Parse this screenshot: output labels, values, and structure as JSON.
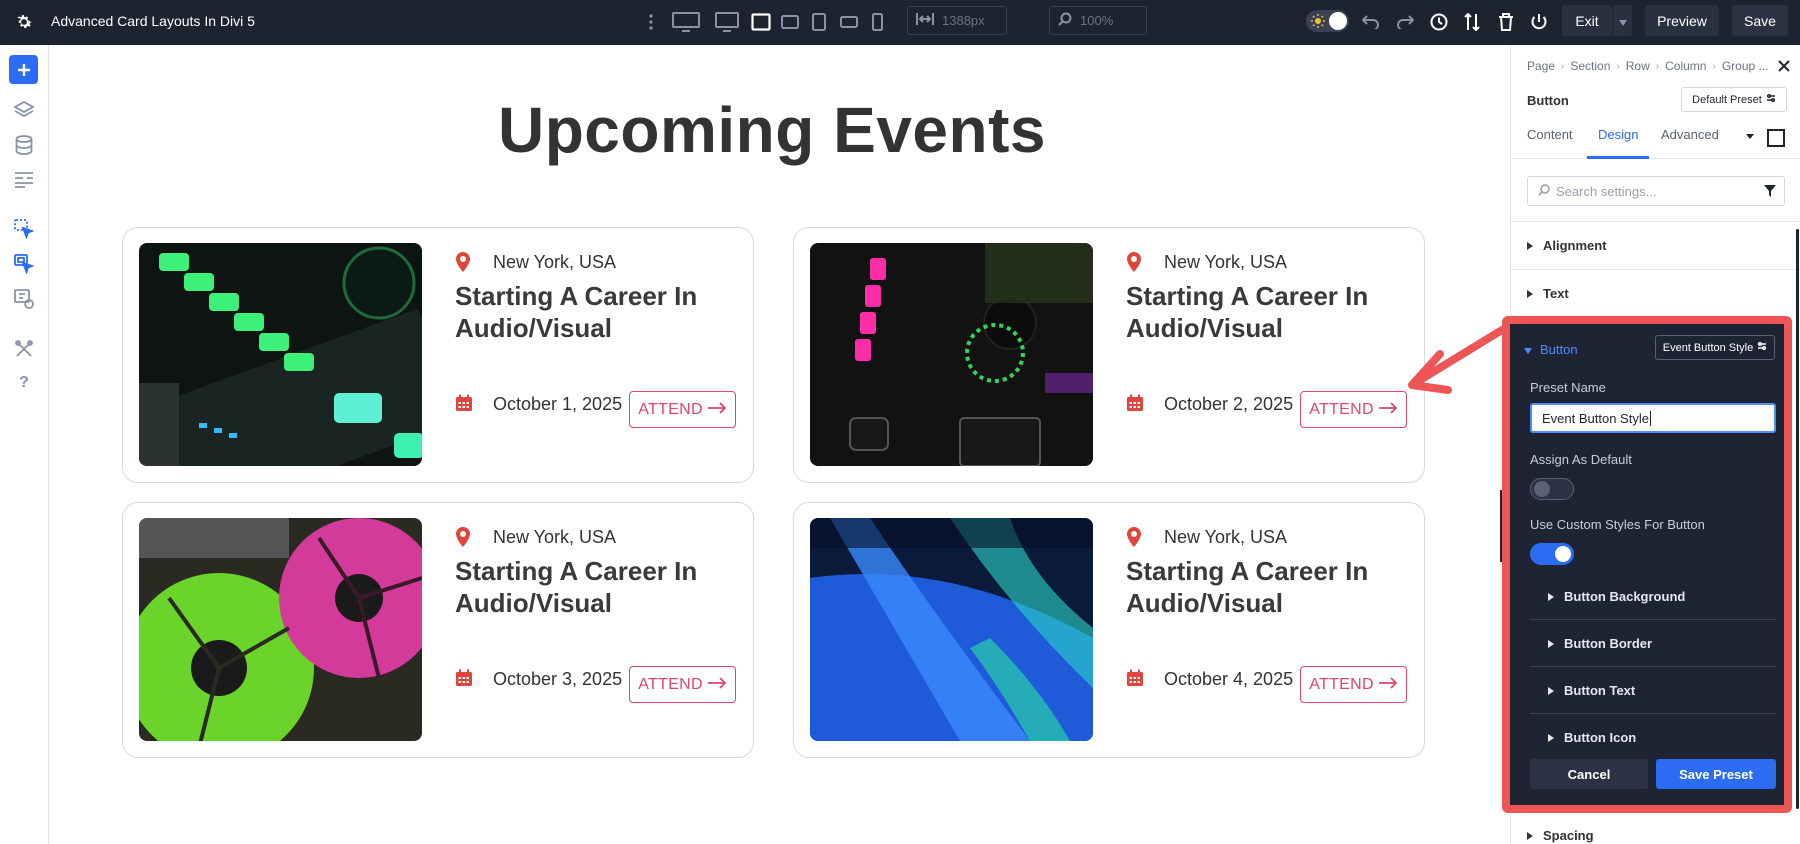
{
  "topbar": {
    "title": "Advanced Card Layouts In Divi 5",
    "width_value": "1388px",
    "zoom_value": "100%",
    "exit_label": "Exit",
    "preview_label": "Preview",
    "save_label": "Save",
    "icons": [
      "gear-icon",
      "more-vertical-icon",
      "desktop-wide-icon",
      "desktop-icon",
      "laptop-icon",
      "tablet-landscape-icon",
      "tablet-portrait-icon",
      "phone-landscape-icon",
      "phone-portrait-icon",
      "width-icon",
      "zoom-icon",
      "theme-toggle",
      "undo-icon",
      "redo-icon",
      "history-icon",
      "sort-icon",
      "trash-icon",
      "power-icon",
      "chevron-down-icon"
    ]
  },
  "leftbar": {
    "icons": [
      "add-icon",
      "layers-icon",
      "database-icon",
      "layout-icon",
      "click-module-icon",
      "click-multi-icon",
      "page-settings-icon",
      "tools-icon",
      "help-icon"
    ]
  },
  "page": {
    "title": "Upcoming Events",
    "cards": [
      {
        "location": "New York, USA",
        "title": "Starting A Career In Audio/Visual",
        "date": "October 1, 2025",
        "button": "ATTEND"
      },
      {
        "location": "New York, USA",
        "title": "Starting A Career In Audio/Visual",
        "date": "October 2, 2025",
        "button": "ATTEND"
      },
      {
        "location": "New York, USA",
        "title": "Starting A Career In Audio/Visual",
        "date": "October 3, 2025",
        "button": "ATTEND"
      },
      {
        "location": "New York, USA",
        "title": "Starting A Career In Audio/Visual",
        "date": "October 4, 2025",
        "button": "ATTEND"
      }
    ]
  },
  "panel": {
    "breadcrumb": [
      "Page",
      "Section",
      "Row",
      "Column",
      "Group ..."
    ],
    "module_name": "Button",
    "preset_label": "Default Preset",
    "tabs": [
      "Content",
      "Design",
      "Advanced"
    ],
    "active_tab": "Design",
    "search_placeholder": "Search settings...",
    "sections": {
      "alignment": "Alignment",
      "text": "Text",
      "spacing": "Spacing"
    },
    "button_group": {
      "title": "Button",
      "preset_badge": "Event Button Style",
      "preset_name_label": "Preset Name",
      "preset_name_value": "Event Button Style",
      "assign_default_label": "Assign As Default",
      "assign_default_on": false,
      "custom_styles_label": "Use Custom Styles For Button",
      "custom_styles_on": true,
      "subsections": [
        "Button Background",
        "Button Border",
        "Button Text",
        "Button Icon"
      ],
      "cancel_label": "Cancel",
      "save_preset_label": "Save Preset"
    }
  },
  "colors": {
    "accent_blue": "#2b6cf2",
    "highlight_red": "#ee5555",
    "attend_pink": "#e0456a",
    "icon_red": "#e0453c",
    "topbar_bg": "#1e2330"
  }
}
